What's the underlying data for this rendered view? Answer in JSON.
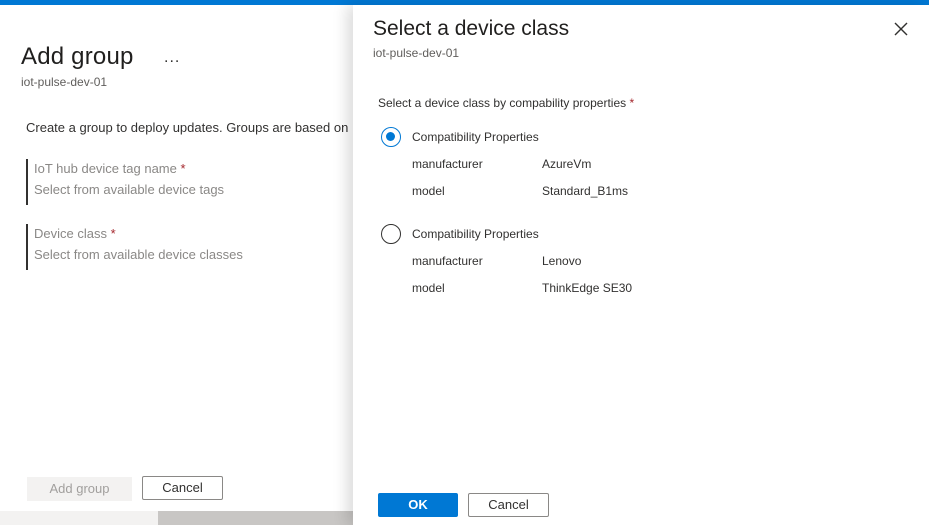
{
  "background_blade": {
    "title": "Add group",
    "more": "...",
    "subtitle": "iot-pulse-dev-01",
    "description": "Create a group to deploy updates. Groups are based on I",
    "fields": [
      {
        "label": "IoT hub device tag name",
        "required": "*",
        "placeholder": "Select from available device tags"
      },
      {
        "label": "Device class",
        "required": "*",
        "placeholder": "Select from available device classes"
      }
    ],
    "add_group_label": "Add group",
    "cancel_label": "Cancel"
  },
  "panel": {
    "title": "Select a device class",
    "subtitle": "iot-pulse-dev-01",
    "prompt": "Select a device class by compability properties",
    "prompt_required": "*",
    "options": [
      {
        "label": "Compatibility Properties",
        "selected": true,
        "properties": [
          {
            "key": "manufacturer",
            "value": "AzureVm"
          },
          {
            "key": "model",
            "value": "Standard_B1ms"
          }
        ]
      },
      {
        "label": "Compatibility Properties",
        "selected": false,
        "properties": [
          {
            "key": "manufacturer",
            "value": "Lenovo"
          },
          {
            "key": "model",
            "value": "ThinkEdge SE30"
          }
        ]
      }
    ],
    "ok_label": "OK",
    "cancel_label": "Cancel"
  },
  "colors": {
    "accent": "#0078d4",
    "required": "#a4262c"
  }
}
